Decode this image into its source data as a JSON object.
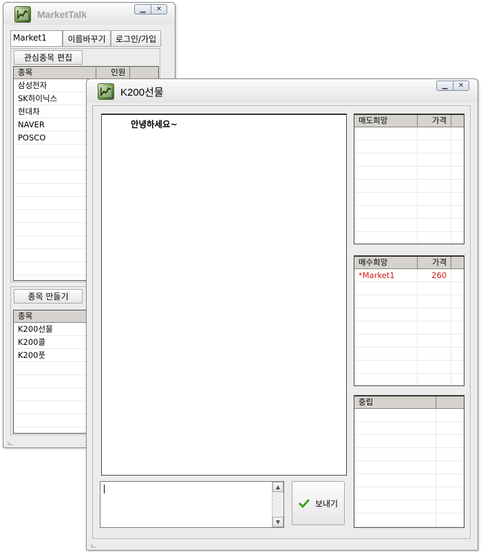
{
  "market_window": {
    "title": "MarketTalk",
    "username_value": "Market1",
    "rename_button": "이름바꾸기",
    "login_button": "로그인/가입",
    "edit_watchlist_button": "관심종목 편집",
    "watchlist_headers": [
      "종목",
      "인원"
    ],
    "watchlist_rows": [
      {
        "name": "삼성전자",
        "count": ""
      },
      {
        "name": "SK하이닉스",
        "count": ""
      },
      {
        "name": "현대차",
        "count": ""
      },
      {
        "name": "NAVER",
        "count": ""
      },
      {
        "name": "POSCO",
        "count": ""
      }
    ],
    "create_item_button": "종목 만들기",
    "items_header": "종목",
    "items_rows": [
      "K200선물",
      "K200콜",
      "K200풋"
    ]
  },
  "chat_window": {
    "title": "K200선물",
    "chat_message": "안녕하세요~",
    "message_input_value": "",
    "send_button": "보내기",
    "sell_table": {
      "headers": [
        "매도희망",
        "가격"
      ],
      "rows": []
    },
    "buy_table": {
      "headers": [
        "매수희망",
        "가격"
      ],
      "rows": [
        {
          "name": "*Market1",
          "price": "260"
        }
      ]
    },
    "neutral_table": {
      "headers": [
        "중립",
        ""
      ],
      "rows": []
    }
  },
  "colors": {
    "highlight_text": "#d01818",
    "grid_header": "#d6d3ce",
    "window_bg": "#ececec"
  },
  "icons": {
    "app": "stock-chart-icon",
    "minimize": "minimize-icon",
    "close": "close-icon",
    "send": "checkmark-icon"
  }
}
